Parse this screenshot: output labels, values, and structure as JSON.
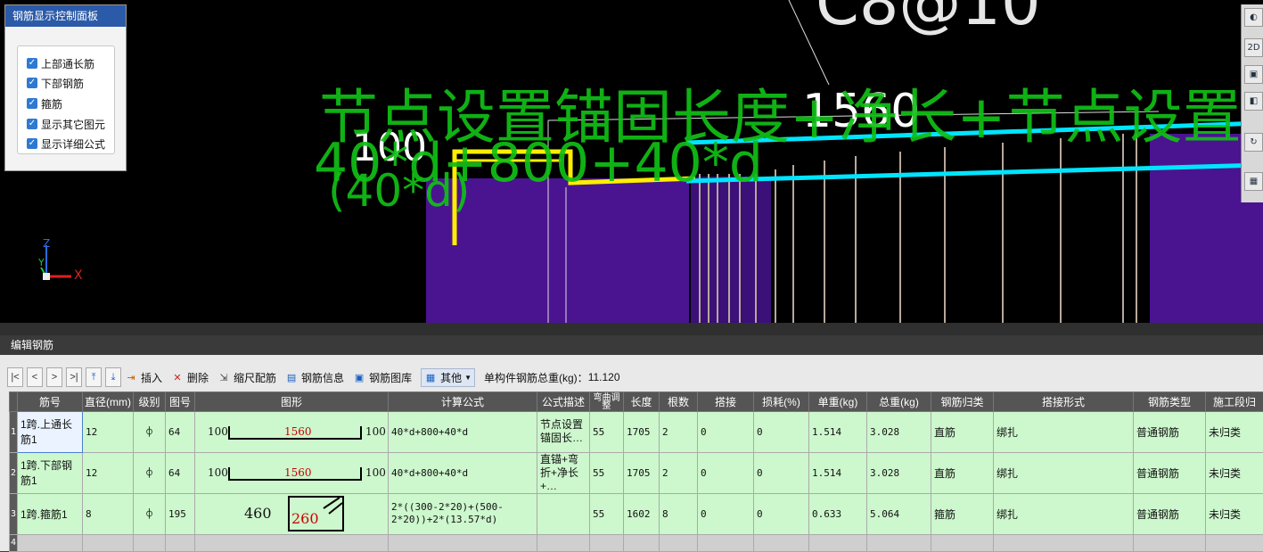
{
  "control_panel": {
    "title": "钢筋显示控制面板",
    "options": [
      {
        "label": "上部通长筋",
        "checked": true
      },
      {
        "label": "下部钢筋",
        "checked": true
      },
      {
        "label": "箍筋",
        "checked": true
      },
      {
        "label": "显示其它图元",
        "checked": true
      },
      {
        "label": "显示详细公式",
        "checked": true
      }
    ]
  },
  "viewport": {
    "formula_overlay_1": "节点设置锚固长度+净长+节点设置锚",
    "formula_overlay_2": "40*d+800+40*d",
    "formula_overlay_3": "(40*d)",
    "dim_left": "100",
    "dim_mid": "1560",
    "axis_z": "Z",
    "axis_y": "Y",
    "axis_x": "X",
    "colors": {
      "top_bar": "#ffee00",
      "bottom_bar": "#00e5ff",
      "column": "#4a1490",
      "formula_text": "#11c016"
    }
  },
  "edit_panel": {
    "title": "编辑钢筋",
    "toolbar": {
      "nav": [
        "|<",
        "<",
        ">",
        ">|"
      ],
      "insert": "插入",
      "delete": "删除",
      "scale": "缩尺配筋",
      "info": "钢筋信息",
      "library": "钢筋图库",
      "other": "其他",
      "total_label": "单构件钢筋总重(kg)：",
      "total_value": "11.120"
    },
    "columns": [
      "筋号",
      "直径(mm)",
      "级别",
      "图号",
      "图形",
      "计算公式",
      "公式描述",
      "弯曲调整",
      "长度",
      "根数",
      "搭接",
      "损耗(%)",
      "单重(kg)",
      "总重(kg)",
      "钢筋归类",
      "搭接形式",
      "钢筋类型",
      "施工段归"
    ],
    "rows": [
      {
        "num": "1",
        "name": "1跨.上通长筋1",
        "dia": "12",
        "grade": "⌽",
        "fig": "64",
        "shape_left": "100",
        "shape_mid": "1560",
        "shape_right": "100",
        "formula": "40*d+800+40*d",
        "desc": "节点设置锚固长…",
        "bend": "55",
        "length": "1705",
        "count": "2",
        "lap": "0",
        "loss": "0",
        "unit_w": "1.514",
        "total_w": "3.028",
        "category": "直筋",
        "lap_type": "绑扎",
        "bar_type": "普通钢筋",
        "stage": "未归类"
      },
      {
        "num": "2",
        "name": "1跨.下部钢筋1",
        "dia": "12",
        "grade": "⌽",
        "fig": "64",
        "shape_left": "100",
        "shape_mid": "1560",
        "shape_right": "100",
        "formula": "40*d+800+40*d",
        "desc": "直锚+弯折+净长+…",
        "bend": "55",
        "length": "1705",
        "count": "2",
        "lap": "0",
        "loss": "0",
        "unit_w": "1.514",
        "total_w": "3.028",
        "category": "直筋",
        "lap_type": "绑扎",
        "bar_type": "普通钢筋",
        "stage": "未归类"
      },
      {
        "num": "3",
        "name": "1跨.箍筋1",
        "dia": "8",
        "grade": "⌽",
        "fig": "195",
        "shape_left": "460",
        "shape_mid": "260",
        "shape_right": "",
        "formula": "2*((300-2*20)+(500-2*20))+2*(13.57*d)",
        "desc": "",
        "bend": "55",
        "length": "1602",
        "count": "8",
        "lap": "0",
        "loss": "0",
        "unit_w": "0.633",
        "total_w": "5.064",
        "category": "箍筋",
        "lap_type": "绑扎",
        "bar_type": "普通钢筋",
        "stage": "未归类"
      }
    ],
    "empty_row_num": "4"
  }
}
